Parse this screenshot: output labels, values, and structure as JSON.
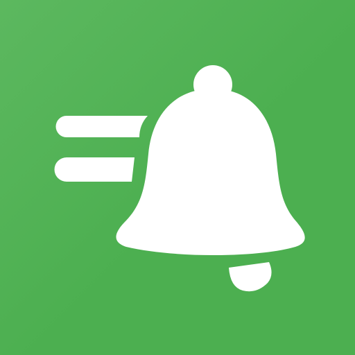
{
  "icon": {
    "name": "notification-bell-icon",
    "background_color": "#4caf50",
    "background_highlight_color": "#5cb85f",
    "foreground_color": "#ffffff",
    "motion_lines": 2
  }
}
